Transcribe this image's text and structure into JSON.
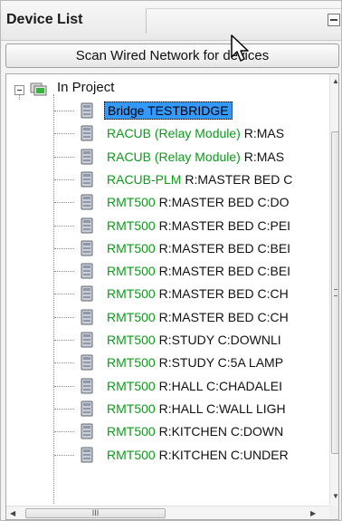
{
  "panel": {
    "title": "Device List",
    "scan_button": "Scan Wired Network for devices"
  },
  "tree": {
    "root_label": "In Project",
    "items": [
      {
        "type": "Bridge TESTBRIDGE",
        "loc": "",
        "selected": true
      },
      {
        "type": "RACUB (Relay Module)",
        "loc": " R:MAS"
      },
      {
        "type": "RACUB (Relay Module)",
        "loc": " R:MAS"
      },
      {
        "type": "RACUB-PLM",
        "loc": " R:MASTER BED C"
      },
      {
        "type": "RMT500",
        "loc": " R:MASTER BED C:DO"
      },
      {
        "type": "RMT500",
        "loc": " R:MASTER BED C:PEI"
      },
      {
        "type": "RMT500",
        "loc": " R:MASTER BED C:BEI"
      },
      {
        "type": "RMT500",
        "loc": " R:MASTER BED C:BEI"
      },
      {
        "type": "RMT500",
        "loc": " R:MASTER BED C:CH"
      },
      {
        "type": "RMT500",
        "loc": " R:MASTER BED C:CH"
      },
      {
        "type": "RMT500",
        "loc": " R:STUDY  C:DOWNLI"
      },
      {
        "type": "RMT500",
        "loc": " R:STUDY  C:5A LAMP"
      },
      {
        "type": "RMT500",
        "loc": " R:HALL  C:CHADALEI"
      },
      {
        "type": "RMT500",
        "loc": " R:HALL  C:WALL LIGH"
      },
      {
        "type": "RMT500",
        "loc": " R:KITCHEN  C:DOWN"
      },
      {
        "type": "RMT500",
        "loc": " R:KITCHEN  C:UNDER"
      }
    ]
  },
  "scrollbars": {
    "h_thumb_grip": "III"
  },
  "colors": {
    "device_type_text": "#0a9b18",
    "selection": "#3399ff"
  }
}
